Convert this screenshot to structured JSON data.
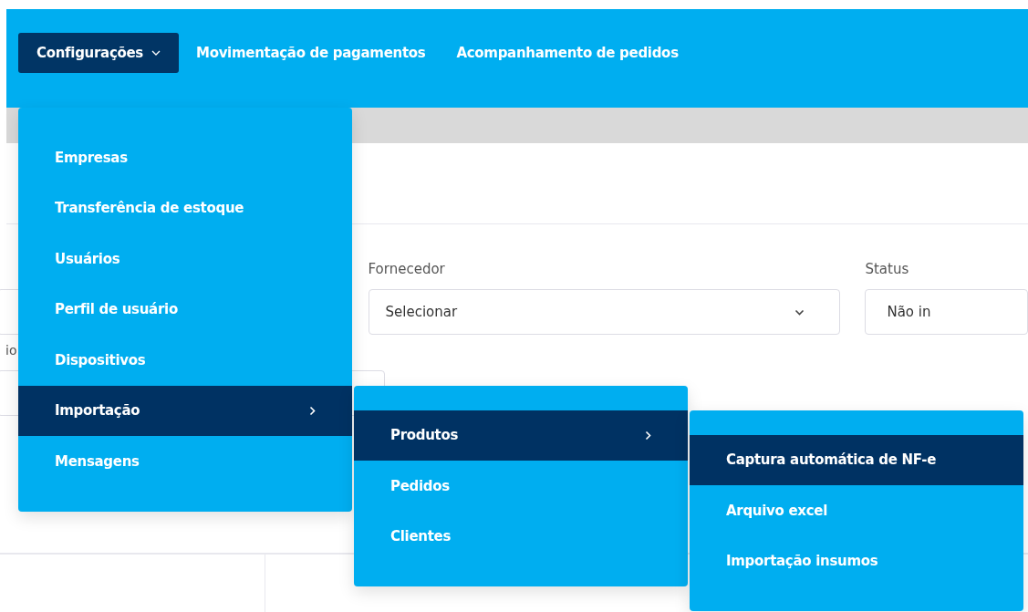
{
  "nav": [
    {
      "label": "Configurações",
      "selected": true,
      "dropdown": true
    },
    {
      "label": "Movimentação de pagamentos",
      "selected": false,
      "dropdown": false
    },
    {
      "label": "Acompanhamento de pedidos",
      "selected": false,
      "dropdown": false
    }
  ],
  "menu": [
    {
      "label": "Empresas",
      "selected": false
    },
    {
      "label": "Transferência de estoque",
      "selected": false
    },
    {
      "label": "Usuários",
      "selected": false
    },
    {
      "label": "Perfil de usuário",
      "selected": false
    },
    {
      "label": "Dispositivos",
      "selected": false
    },
    {
      "label": "Importação",
      "selected": true,
      "children": [
        {
          "label": "Produtos",
          "selected": true,
          "children": [
            {
              "label": "Captura automática de NF-e",
              "selected": true
            },
            {
              "label": "Arquivo excel",
              "selected": false
            },
            {
              "label": "Importação insumos",
              "selected": false
            }
          ]
        },
        {
          "label": "Pedidos",
          "selected": false
        },
        {
          "label": "Clientes",
          "selected": false
        }
      ]
    },
    {
      "label": "Mensagens",
      "selected": false
    }
  ],
  "filters": [
    {
      "kind": "select",
      "label": "Fornecedor",
      "placeholder": "Selecionar"
    },
    {
      "kind": "text",
      "label": "Status",
      "value": "Não in"
    }
  ],
  "cut_label": "io"
}
